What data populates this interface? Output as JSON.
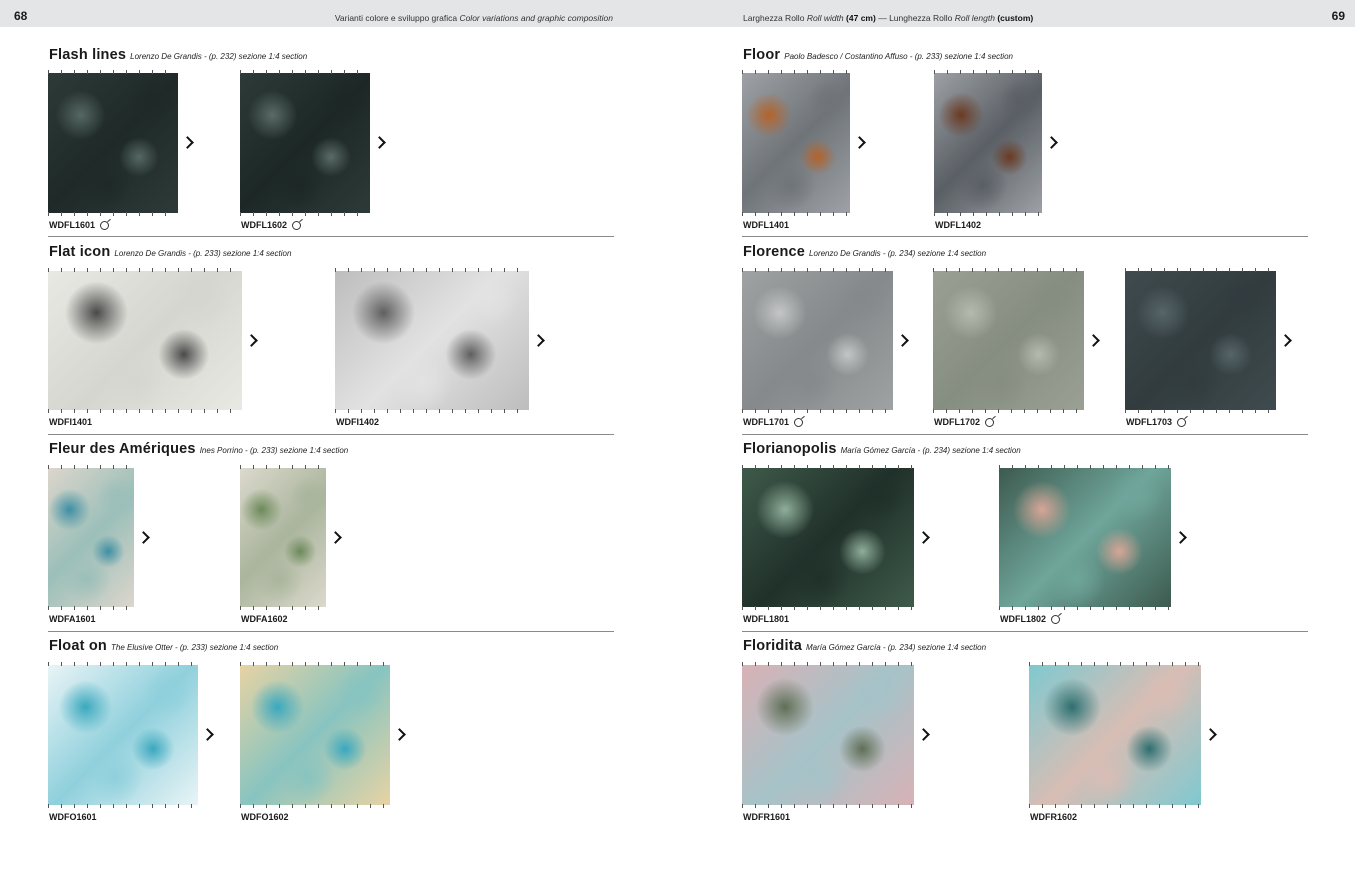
{
  "header": {
    "left_page_number": "68",
    "right_page_number": "69",
    "left_title_it": "Varianti colore e sviluppo grafica",
    "left_title_en": "Color variations and graphic composition",
    "right_width_it": "Larghezza Rollo",
    "right_width_en": "Roll width",
    "right_width_value": "(47 cm)",
    "right_sep": "—",
    "right_length_it": "Lunghezza Rollo",
    "right_length_en": "Roll length",
    "right_length_value": "(custom)"
  },
  "sections": [
    {
      "name": "Flash lines",
      "meta": "Lorenzo De Grandis - (p. 232) sezione 1:4 section",
      "items": [
        {
          "code": "WDFL1601",
          "curl": true,
          "colors": [
            "#2d3a37",
            "#566862",
            "#1f2a28"
          ]
        },
        {
          "code": "WDFL1602",
          "curl": true,
          "colors": [
            "#2c3a38",
            "#5a6b67",
            "#1d2826"
          ]
        }
      ]
    },
    {
      "name": "Flat icon",
      "meta": "Lorenzo De Grandis - (p. 233) sezione 1:4 section",
      "items": [
        {
          "code": "WDFI1401",
          "curl": false,
          "colors": [
            "#e9e9e4",
            "#4a4a4a",
            "#d6d6d0"
          ]
        },
        {
          "code": "WDFI1402",
          "curl": false,
          "colors": [
            "#bdbdbd",
            "#5f5f5f",
            "#e2e2e2"
          ]
        }
      ]
    },
    {
      "name": "Fleur des Amériques",
      "meta": "Ines Porrino  - (p. 233) sezione 1:4 section",
      "items": [
        {
          "code": "WDFA1601",
          "curl": false,
          "colors": [
            "#ddd6cc",
            "#3f8fa3",
            "#9bbfb9"
          ]
        },
        {
          "code": "WDFA1602",
          "curl": false,
          "colors": [
            "#dcd9cd",
            "#6c8a5a",
            "#aab59d"
          ]
        }
      ]
    },
    {
      "name": "Float on",
      "meta": "The Elusive Otter - (p. 233) sezione 1:4 section",
      "items": [
        {
          "code": "WDFO1601",
          "curl": false,
          "colors": [
            "#e9f4f6",
            "#3aa8be",
            "#8fd0dc"
          ]
        },
        {
          "code": "WDFO1602",
          "curl": false,
          "colors": [
            "#e7d3a4",
            "#3aa8be",
            "#88c4c0"
          ]
        }
      ]
    },
    {
      "name": "Floor",
      "meta": "Paolo Badesco / Costantino Affuso  - (p. 233) sezione 1:4 section",
      "items": [
        {
          "code": "WDFL1401",
          "curl": false,
          "colors": [
            "#9ea2a6",
            "#b4632b",
            "#6f7479"
          ]
        },
        {
          "code": "WDFL1402",
          "curl": false,
          "colors": [
            "#9da1a5",
            "#6b3a22",
            "#5a5f65"
          ]
        }
      ]
    },
    {
      "name": "Florence",
      "meta": "Lorenzo De Grandis - (p. 234) sezione 1:4 section",
      "items": [
        {
          "code": "WDFL1701",
          "curl": true,
          "colors": [
            "#9fa2a3",
            "#c3c5c6",
            "#85898b"
          ]
        },
        {
          "code": "WDFL1702",
          "curl": true,
          "colors": [
            "#9aa194",
            "#b4baae",
            "#868d81"
          ]
        },
        {
          "code": "WDFL1703",
          "curl": true,
          "colors": [
            "#3f4b4e",
            "#56656a",
            "#323c3f"
          ]
        }
      ]
    },
    {
      "name": "Florianopolis",
      "meta": "María Gómez García - (p. 234) sezione 1:4 section",
      "items": [
        {
          "code": "WDFL1801",
          "curl": false,
          "colors": [
            "#3e5a4a",
            "#8fae9a",
            "#20302a"
          ]
        },
        {
          "code": "WDFL1802",
          "curl": true,
          "colors": [
            "#3d5a4f",
            "#d8a596",
            "#6fa59a"
          ]
        }
      ]
    },
    {
      "name": "Floridita",
      "meta": "María Gómez García - (p. 234) sezione 1:4 section",
      "items": [
        {
          "code": "WDFR1601",
          "curl": false,
          "colors": [
            "#d8b2b6",
            "#5f6f56",
            "#a5c3c8"
          ]
        },
        {
          "code": "WDFR1602",
          "curl": false,
          "colors": [
            "#7fc9d0",
            "#2f6e6f",
            "#d8bdb4"
          ]
        }
      ]
    }
  ]
}
